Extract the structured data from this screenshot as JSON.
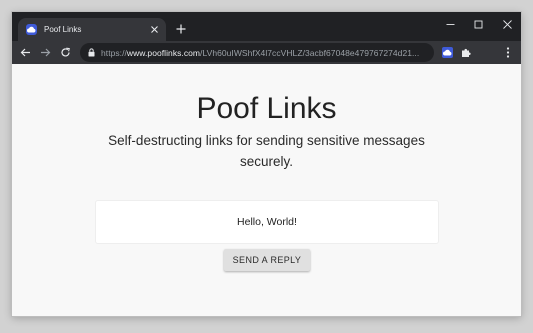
{
  "browser": {
    "tab": {
      "title": "Poof Links",
      "favicon": "poof-cloud-icon",
      "close_icon": "close-icon"
    },
    "new_tab_icon": "plus-icon",
    "window_controls": [
      "minimize-icon",
      "maximize-icon",
      "close-icon"
    ],
    "toolbar": {
      "back_icon": "arrow-left-icon",
      "forward_icon": "arrow-right-icon",
      "reload_icon": "reload-icon",
      "url_scheme": "https://",
      "url_host": "www.pooflinks.com",
      "url_path": "/LVh60uIWShfX4l7ccVHLZ/3acbf67048e479767274d21...",
      "extensions": [
        "poof-extension-icon",
        "puzzle-icon"
      ],
      "menu_icon": "kebab-menu-icon"
    },
    "colors": {
      "frame": "#202124",
      "toolbar": "#35363a",
      "accent": "#3f5bd9"
    }
  },
  "page": {
    "title": "Poof Links",
    "subtitle": "Self-destructing links for sending sensitive messages securely.",
    "message": "Hello, World!",
    "reply_button_label": "SEND A REPLY"
  }
}
